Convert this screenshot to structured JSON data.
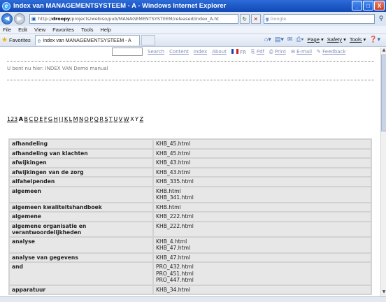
{
  "window": {
    "title": "Index van MANAGEMENTSYSTEEM - A - Windows Internet Explorer",
    "minimize": "_",
    "maximize": "□",
    "close": "X"
  },
  "address": {
    "url_prefix": "http://",
    "url_host": "droopy",
    "url_path": "/projects/webiso/pub/MANAGEMENTSYSTEEM/released/index_A.ht",
    "search_placeholder": "Google"
  },
  "menu": [
    "File",
    "Edit",
    "View",
    "Favorites",
    "Tools",
    "Help"
  ],
  "favorites_label": "Favorites",
  "tab_title": "Index van MANAGEMENTSYSTEEM - A",
  "commands": [
    "Page",
    "Safety",
    "Tools"
  ],
  "toplinks": {
    "search": "Search",
    "content": "Content",
    "index": "Index",
    "about": "About",
    "fr": "FR",
    "pdf": "Pdf",
    "print": "Print",
    "email": "E-mail",
    "feedback": "Feedback"
  },
  "breadcrumb": "U bent nu hier: INDEX VAN Demo manual",
  "letters": {
    "first": "123",
    "current": "A",
    "linked": [
      "B",
      "C",
      "D",
      "E",
      "F",
      "G",
      "H",
      "I",
      "J",
      "K",
      "L",
      "M",
      "N",
      "O",
      "P",
      "Q",
      "R",
      "S",
      "T",
      "U",
      "V",
      "W"
    ],
    "unlinked": [
      "X",
      "Y"
    ],
    "last": "Z"
  },
  "index_rows": [
    {
      "term": "afhandeling",
      "files": [
        "KHB_45.html"
      ]
    },
    {
      "term": "afhandeling van klachten",
      "files": [
        "KHB_45.html"
      ]
    },
    {
      "term": "afwijkingen",
      "files": [
        "KHB_43.html"
      ]
    },
    {
      "term": "afwijkingen van de zorg",
      "files": [
        "KHB_43.html"
      ]
    },
    {
      "term": "alfahelpenden",
      "files": [
        "KHB_335.html"
      ]
    },
    {
      "term": "algemeen",
      "files": [
        "KHB.html",
        "KHB_341.html"
      ]
    },
    {
      "term": "algemeen kwaliteitshandboek",
      "files": [
        "KHB.html"
      ]
    },
    {
      "term": "algemene",
      "files": [
        "KHB_222.html"
      ]
    },
    {
      "term": "algemene organisatie en verantwoordelijkheden",
      "files": [
        "KHB_222.html"
      ]
    },
    {
      "term": "analyse",
      "files": [
        "KHB_4.html",
        "KHB_47.html"
      ]
    },
    {
      "term": "analyse van gegevens",
      "files": [
        "KHB_47.html"
      ]
    },
    {
      "term": "and",
      "files": [
        "PRO_432.html",
        "PRO_451.html",
        "PRO_447.html"
      ]
    },
    {
      "term": "apparatuur",
      "files": [
        "KHB_34.html"
      ]
    }
  ]
}
